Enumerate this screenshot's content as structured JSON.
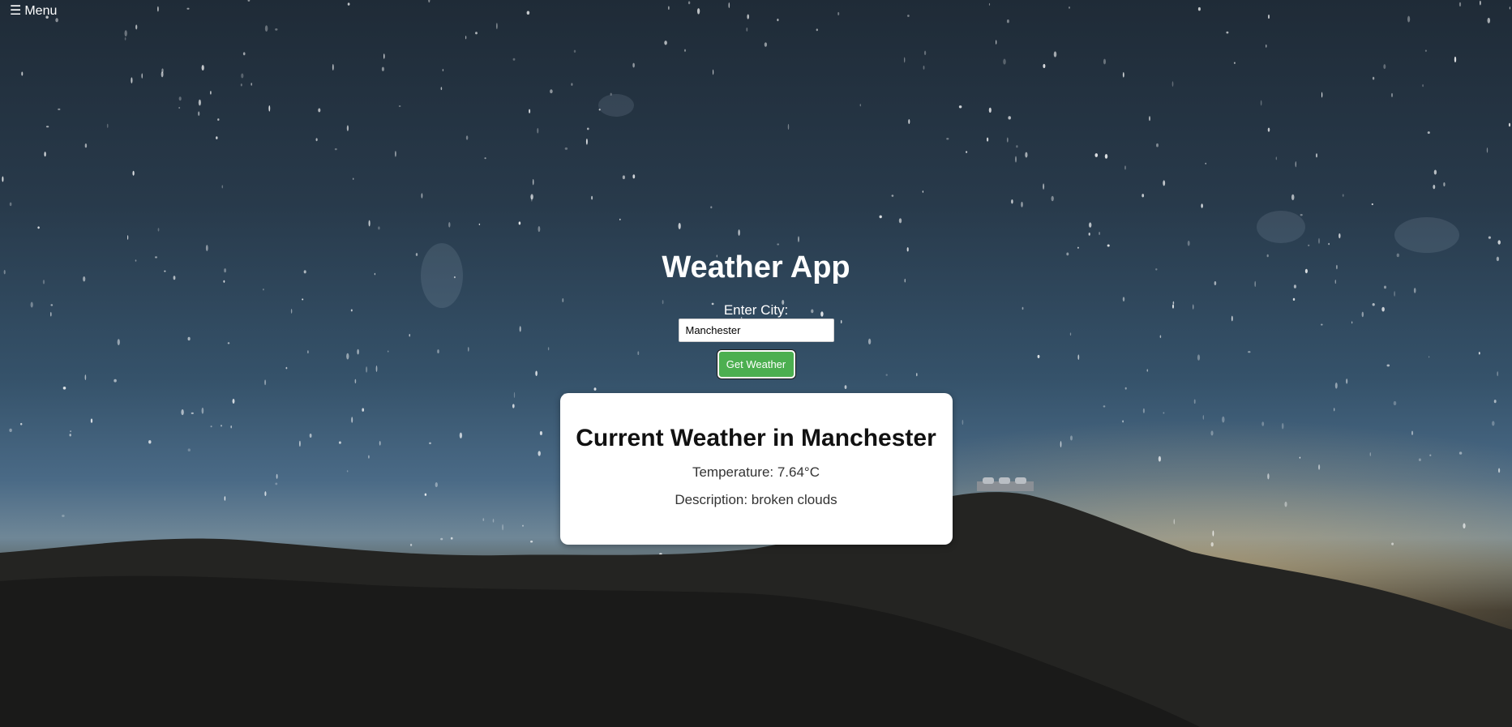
{
  "menu": {
    "icon": "hamburger-icon",
    "label": "Menu"
  },
  "app": {
    "title": "Weather App",
    "city_label": "Enter City:",
    "city_value": "Manchester",
    "button_label": "Get Weather",
    "button_color": "#4caf50"
  },
  "weather": {
    "heading": "Current Weather in Manchester",
    "temperature": "Temperature: 7.64°C",
    "description": "Description: broken clouds"
  }
}
